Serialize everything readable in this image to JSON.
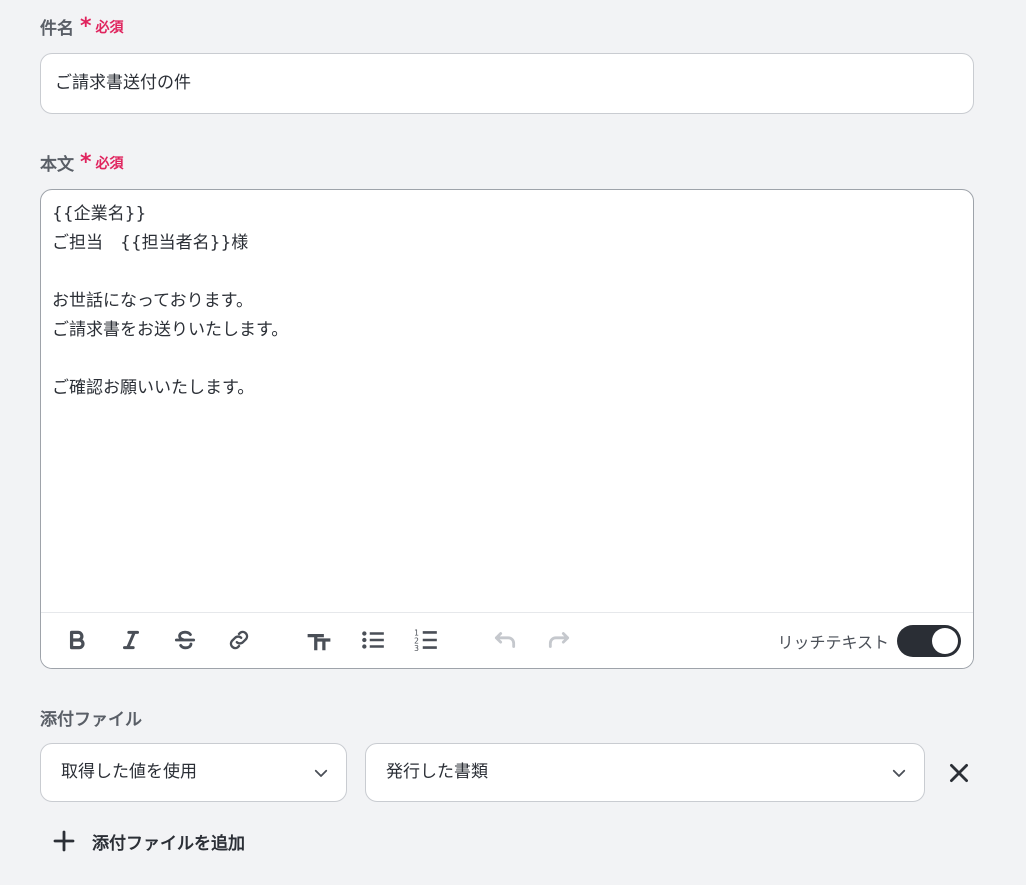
{
  "subject": {
    "label": "件名",
    "required_mark": "*",
    "required_text": "必須",
    "value": "ご請求書送付の件"
  },
  "body": {
    "label": "本文",
    "required_mark": "*",
    "required_text": "必須",
    "lines": [
      "{{企業名}}",
      "ご担当　{{担当者名}}様",
      "",
      "お世話になっております。",
      "ご請求書をお送りいたします。",
      "",
      "ご確認お願いいたします。"
    ]
  },
  "toolbar": {
    "buttons": [
      {
        "name": "bold-icon",
        "enabled": true
      },
      {
        "name": "italic-icon",
        "enabled": true
      },
      {
        "name": "strikethrough-icon",
        "enabled": true
      },
      {
        "name": "link-icon",
        "enabled": true
      },
      {
        "name": "text-size-icon",
        "enabled": true
      },
      {
        "name": "bulleted-list-icon",
        "enabled": true
      },
      {
        "name": "numbered-list-icon",
        "enabled": true
      },
      {
        "name": "undo-icon",
        "enabled": false
      },
      {
        "name": "redo-icon",
        "enabled": false
      }
    ],
    "rich_text_label": "リッチテキスト",
    "rich_text_enabled": true
  },
  "attachments": {
    "label": "添付ファイル",
    "source_select": {
      "value": "取得した値を使用",
      "icon": "chevron-down-icon"
    },
    "document_select": {
      "value": "発行した書類",
      "icon": "chevron-down-icon"
    },
    "remove_icon": "close-icon",
    "add_label": "添付ファイルを追加",
    "add_icon": "plus-icon"
  }
}
